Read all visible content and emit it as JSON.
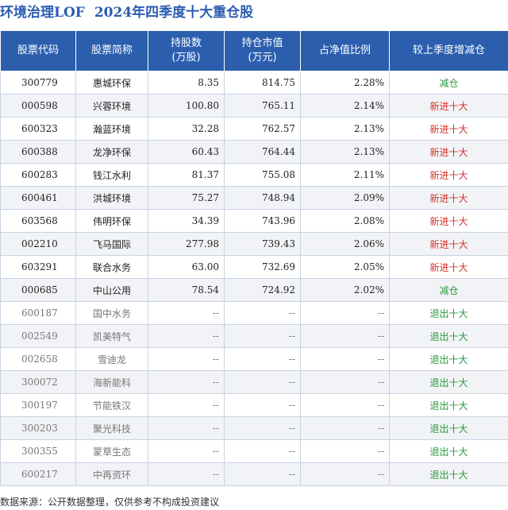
{
  "header": {
    "fund_name": "环境治理LOF",
    "period_title": "2024年四季度十大重仓股"
  },
  "table": {
    "columns": [
      "股票代码",
      "股票简称",
      "持股数\n(万股)",
      "持仓市值\n(万元)",
      "占净值比例",
      "较上季度增减仓"
    ],
    "rows": [
      {
        "code": "300779",
        "name": "惠城环保",
        "shares": "8.35",
        "value": "814.75",
        "ratio": "2.28%",
        "change": "减仓",
        "status": "reduce"
      },
      {
        "code": "000598",
        "name": "兴蓉环境",
        "shares": "100.80",
        "value": "765.11",
        "ratio": "2.14%",
        "change": "新进十大",
        "status": "new"
      },
      {
        "code": "600323",
        "name": "瀚蓝环境",
        "shares": "32.28",
        "value": "762.57",
        "ratio": "2.13%",
        "change": "新进十大",
        "status": "new"
      },
      {
        "code": "600388",
        "name": "龙净环保",
        "shares": "60.43",
        "value": "764.44",
        "ratio": "2.13%",
        "change": "新进十大",
        "status": "new"
      },
      {
        "code": "600283",
        "name": "钱江水利",
        "shares": "81.37",
        "value": "755.08",
        "ratio": "2.11%",
        "change": "新进十大",
        "status": "new"
      },
      {
        "code": "600461",
        "name": "洪城环境",
        "shares": "75.27",
        "value": "748.94",
        "ratio": "2.09%",
        "change": "新进十大",
        "status": "new"
      },
      {
        "code": "603568",
        "name": "伟明环保",
        "shares": "34.39",
        "value": "743.96",
        "ratio": "2.08%",
        "change": "新进十大",
        "status": "new"
      },
      {
        "code": "002210",
        "name": "飞马国际",
        "shares": "277.98",
        "value": "739.43",
        "ratio": "2.06%",
        "change": "新进十大",
        "status": "new"
      },
      {
        "code": "603291",
        "name": "联合水务",
        "shares": "63.00",
        "value": "732.69",
        "ratio": "2.05%",
        "change": "新进十大",
        "status": "new"
      },
      {
        "code": "000685",
        "name": "中山公用",
        "shares": "78.54",
        "value": "724.92",
        "ratio": "2.02%",
        "change": "减仓",
        "status": "reduce"
      },
      {
        "code": "600187",
        "name": "国中水务",
        "shares": "--",
        "value": "--",
        "ratio": "--",
        "change": "退出十大",
        "status": "exit"
      },
      {
        "code": "002549",
        "name": "凯美特气",
        "shares": "--",
        "value": "--",
        "ratio": "--",
        "change": "退出十大",
        "status": "exit"
      },
      {
        "code": "002658",
        "name": "雪迪龙",
        "shares": "--",
        "value": "--",
        "ratio": "--",
        "change": "退出十大",
        "status": "exit"
      },
      {
        "code": "300072",
        "name": "海新能科",
        "shares": "--",
        "value": "--",
        "ratio": "--",
        "change": "退出十大",
        "status": "exit"
      },
      {
        "code": "300197",
        "name": "节能铁汉",
        "shares": "--",
        "value": "--",
        "ratio": "--",
        "change": "退出十大",
        "status": "exit"
      },
      {
        "code": "300203",
        "name": "聚光科技",
        "shares": "--",
        "value": "--",
        "ratio": "--",
        "change": "退出十大",
        "status": "exit"
      },
      {
        "code": "300355",
        "name": "蒙草生态",
        "shares": "--",
        "value": "--",
        "ratio": "--",
        "change": "退出十大",
        "status": "exit"
      },
      {
        "code": "600217",
        "name": "中再资环",
        "shares": "--",
        "value": "--",
        "ratio": "--",
        "change": "退出十大",
        "status": "exit"
      }
    ]
  },
  "colors": {
    "header_bg": "#2b5fae",
    "title": "#2a5cb0",
    "new": "#d0342c",
    "reduce": "#2a9a3c",
    "exit": "#2a9a3c"
  },
  "footer": {
    "source": "数据来源：公开数据整理，仅供参考不构成投资建议"
  }
}
